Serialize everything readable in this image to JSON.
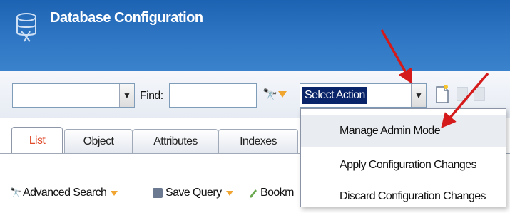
{
  "header": {
    "title": "Database Configuration",
    "icon": "database-config-icon"
  },
  "toolbar": {
    "find_label": "Find:",
    "find_value": "",
    "action_select_value": "Select Action"
  },
  "tabs": [
    {
      "label": "List",
      "active": true
    },
    {
      "label": "Object",
      "active": false
    },
    {
      "label": "Attributes",
      "active": false
    },
    {
      "label": "Indexes",
      "active": false
    }
  ],
  "subtoolbar": {
    "advanced_search": "Advanced Search",
    "save_query": "Save Query",
    "bookmarks": "Bookm"
  },
  "menu": {
    "items": [
      {
        "label": "Manage Admin Mode",
        "highlighted": true
      },
      {
        "label": "Apply Configuration Changes",
        "highlighted": false
      },
      {
        "label": "Discard Configuration Changes",
        "highlighted": false
      }
    ]
  },
  "colors": {
    "header_blue": "#2f77c4",
    "active_tab_text": "#e04b2b",
    "arrow_red": "#d41a1a",
    "selection_navy": "#0a246a"
  }
}
